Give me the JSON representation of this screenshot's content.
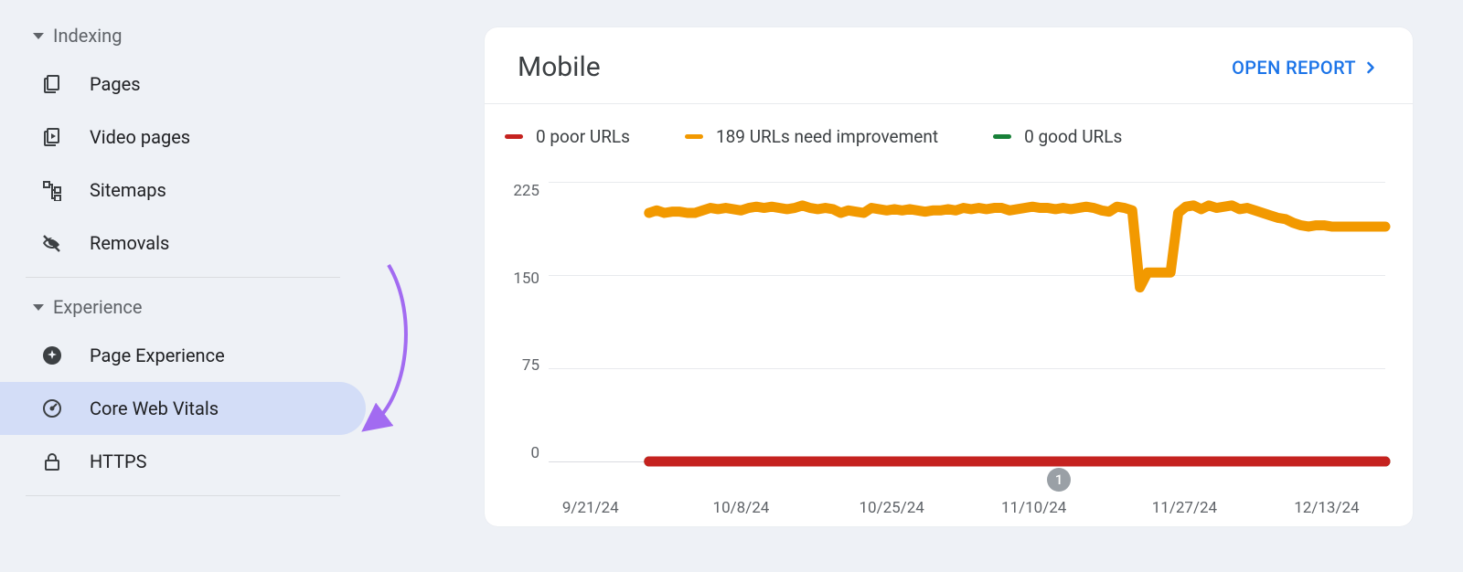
{
  "sidebar": {
    "sections": [
      {
        "label": "Indexing",
        "items": [
          {
            "label": "Pages",
            "icon": "pages"
          },
          {
            "label": "Video pages",
            "icon": "video-pages"
          },
          {
            "label": "Sitemaps",
            "icon": "sitemaps"
          },
          {
            "label": "Removals",
            "icon": "removals"
          }
        ]
      },
      {
        "label": "Experience",
        "items": [
          {
            "label": "Page Experience",
            "icon": "page-experience"
          },
          {
            "label": "Core Web Vitals",
            "icon": "core-web-vitals",
            "selected": true
          },
          {
            "label": "HTTPS",
            "icon": "https"
          }
        ]
      }
    ]
  },
  "card": {
    "title": "Mobile",
    "open_report_label": "OPEN REPORT",
    "legend": [
      {
        "label": "0 poor URLs",
        "color": "#c5221f"
      },
      {
        "label": "189 URLs need improvement",
        "color": "#f29900"
      },
      {
        "label": "0 good URLs",
        "color": "#188038"
      }
    ],
    "event_badge": "1"
  },
  "chart_data": {
    "type": "line",
    "xlabel": "",
    "ylabel": "",
    "ylim": [
      0,
      225
    ],
    "y_ticks": [
      "225",
      "150",
      "75",
      "0"
    ],
    "x_categories": [
      "9/21/24",
      "10/8/24",
      "10/25/24",
      "11/10/24",
      "11/27/24",
      "12/13/24"
    ],
    "x_positions_pct": [
      5,
      23,
      41,
      58,
      76,
      93
    ],
    "event_marker": {
      "x_pct": 61,
      "label": "1"
    },
    "series": [
      {
        "name": "URLs need improvement",
        "color": "#f29900",
        "x_start_pct": 12,
        "x_end_pct": 100,
        "values": [
          200,
          202,
          200,
          201,
          201,
          200,
          200,
          202,
          204,
          203,
          204,
          203,
          202,
          204,
          205,
          204,
          205,
          204,
          203,
          204,
          206,
          204,
          203,
          204,
          203,
          200,
          202,
          201,
          200,
          204,
          203,
          202,
          203,
          202,
          203,
          202,
          201,
          202,
          202,
          203,
          202,
          204,
          203,
          204,
          203,
          204,
          204,
          202,
          203,
          204,
          205,
          204,
          204,
          203,
          204,
          203,
          204,
          205,
          204,
          202,
          201,
          205,
          204,
          202,
          140,
          152,
          152,
          152,
          152,
          200,
          205,
          206,
          203,
          206,
          204,
          205,
          206,
          203,
          204,
          202,
          200,
          198,
          196,
          195,
          192,
          190,
          189,
          190,
          190,
          189,
          189,
          189,
          189,
          189,
          189,
          189,
          189
        ],
        "end_dot": true
      },
      {
        "name": "poor URLs",
        "color": "#c5221f",
        "x_start_pct": 12,
        "x_end_pct": 100,
        "values": [
          0,
          0,
          0,
          0,
          0,
          0,
          0,
          0,
          0,
          0,
          0,
          0,
          0,
          0,
          0,
          0,
          0,
          0,
          0,
          0,
          0,
          0,
          0,
          0,
          0,
          0,
          0,
          0,
          0,
          0,
          0,
          0,
          0,
          0,
          0,
          0,
          0,
          0,
          0,
          0,
          0,
          0,
          0,
          0,
          0,
          0,
          0,
          0,
          0,
          0,
          0,
          0,
          0,
          0,
          0,
          0,
          0,
          0,
          0,
          0,
          0,
          0,
          0,
          0,
          0,
          0,
          0,
          0,
          0,
          0,
          0,
          0,
          0,
          0,
          0,
          0,
          0,
          0,
          0,
          0,
          0,
          0,
          0,
          0,
          0,
          0,
          0,
          0,
          0,
          0,
          0,
          0,
          0,
          0,
          0,
          0,
          0
        ],
        "end_dot": true
      },
      {
        "name": "good URLs",
        "color": "#188038",
        "x_start_pct": 12,
        "x_end_pct": 100,
        "values": [
          0,
          0,
          0,
          0,
          0,
          0,
          0,
          0,
          0,
          0,
          0,
          0,
          0,
          0,
          0,
          0,
          0,
          0,
          0,
          0,
          0,
          0,
          0,
          0,
          0,
          0,
          0,
          0,
          0,
          0,
          0,
          0,
          0,
          0,
          0,
          0,
          0,
          0,
          0,
          0,
          0,
          0,
          0,
          0,
          0,
          0,
          0,
          0,
          0,
          0,
          0,
          0,
          0,
          0,
          0,
          0,
          0,
          0,
          0,
          0,
          0,
          0,
          0,
          0,
          0,
          0,
          0,
          0,
          0,
          0,
          0,
          0,
          0,
          0,
          0,
          0,
          0,
          0,
          0,
          0,
          0,
          0,
          0,
          0,
          0,
          0,
          0,
          0,
          0,
          0,
          0,
          0,
          0,
          0,
          0,
          0,
          0
        ],
        "end_dot": false
      }
    ]
  }
}
